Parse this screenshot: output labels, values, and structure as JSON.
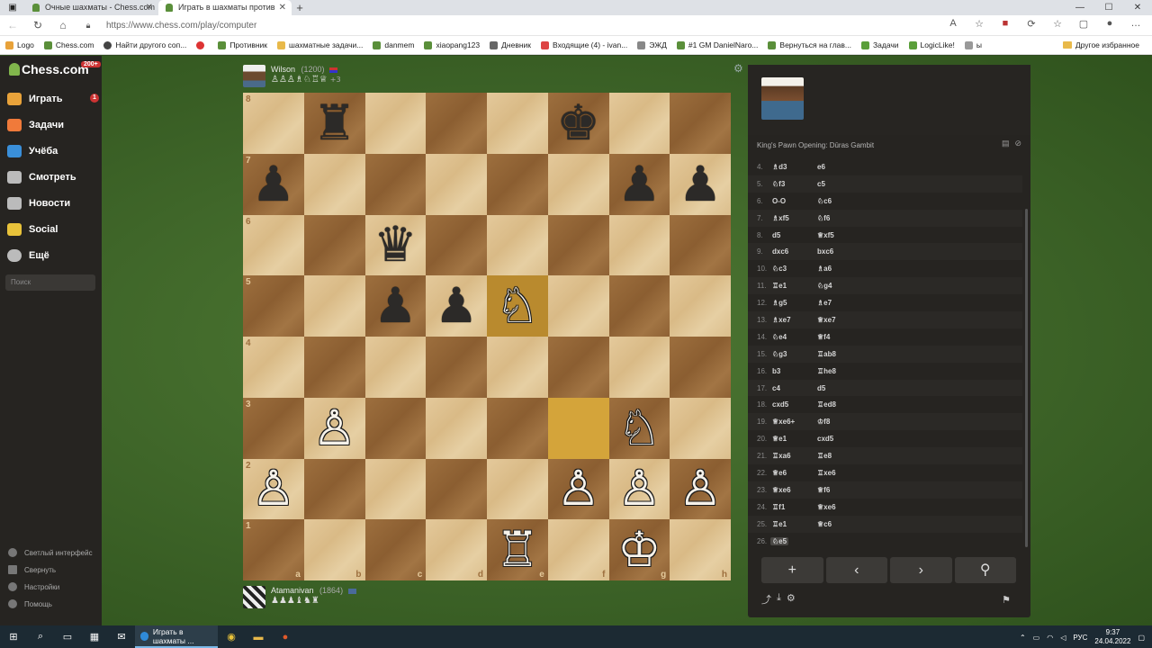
{
  "browser": {
    "tabs": [
      {
        "title": "Очные шахматы - Chess.com",
        "active": false
      },
      {
        "title": "Играть в шахматы против",
        "active": true
      }
    ],
    "url": "https://www.chess.com/play/computer",
    "bookmarks": [
      "Logo",
      "Chess.com",
      "Найти другого соп...",
      "Противник",
      "шахматные задачи...",
      "danmem",
      "xiaopang123",
      "Дневник",
      "Входящие (4) - ivan...",
      "ЭЖД",
      "#1 GM DanielNaro...",
      "Вернуться на глав...",
      "Задачи",
      "LogicLike!",
      "ы"
    ],
    "bookmarks_right": "Другое избранное"
  },
  "sidebar": {
    "logo": "Chess.com",
    "logo_badge": "200+",
    "items": [
      {
        "label": "Играть",
        "badge": "1"
      },
      {
        "label": "Задачи"
      },
      {
        "label": "Учёба"
      },
      {
        "label": "Смотреть"
      },
      {
        "label": "Новости"
      },
      {
        "label": "Social"
      },
      {
        "label": "Ещё"
      }
    ],
    "search_placeholder": "Поиск",
    "bottom": [
      "Светлый интерфейс",
      "Свернуть",
      "Настройки",
      "Помощь"
    ]
  },
  "top_player": {
    "name": "Wilson",
    "rating": "(1200)",
    "captured": "♙♙♙♗♘♖♕",
    "advantage": "+3"
  },
  "bottom_player": {
    "name": "Atamanivan",
    "rating": "(1864)",
    "captured": "♟♟♟♝♞♜"
  },
  "board": {
    "files": [
      "a",
      "b",
      "c",
      "d",
      "e",
      "f",
      "g",
      "h"
    ],
    "ranks": [
      "8",
      "7",
      "6",
      "5",
      "4",
      "3",
      "2",
      "1"
    ],
    "highlight": [
      "e5",
      "f3"
    ],
    "pieces": {
      "b8": "♜",
      "f8": "♚",
      "a7": "♟",
      "g7": "♟",
      "h7": "♟",
      "c6": "♛",
      "c5": "♟",
      "d5": "♟",
      "e5": "♘",
      "b3": "♙",
      "g3": "♘",
      "a2": "♙",
      "f2": "♙",
      "g2": "♙",
      "h2": "♙",
      "e1": "♖",
      "g1": "♔"
    },
    "white_pieces": [
      "e5",
      "b3",
      "g3",
      "a2",
      "f2",
      "g2",
      "h2",
      "e1",
      "g1"
    ]
  },
  "panel": {
    "opening": "King's Pawn Opening: Dūras Gambit",
    "moves": [
      {
        "n": "4.",
        "w": "♗d3",
        "b": "e6"
      },
      {
        "n": "5.",
        "w": "♘f3",
        "b": "c5"
      },
      {
        "n": "6.",
        "w": "O-O",
        "b": "♘c6"
      },
      {
        "n": "7.",
        "w": "♗xf5",
        "b": "♘f6"
      },
      {
        "n": "8.",
        "w": "d5",
        "b": "♕xf5"
      },
      {
        "n": "9.",
        "w": "dxc6",
        "b": "bxc6"
      },
      {
        "n": "10.",
        "w": "♘c3",
        "b": "♗a6"
      },
      {
        "n": "11.",
        "w": "♖e1",
        "b": "♘g4"
      },
      {
        "n": "12.",
        "w": "♗g5",
        "b": "♗e7"
      },
      {
        "n": "13.",
        "w": "♗xe7",
        "b": "♕xe7"
      },
      {
        "n": "14.",
        "w": "♘e4",
        "b": "♕f4"
      },
      {
        "n": "15.",
        "w": "♘g3",
        "b": "♖ab8"
      },
      {
        "n": "16.",
        "w": "b3",
        "b": "♖he8"
      },
      {
        "n": "17.",
        "w": "c4",
        "b": "d5"
      },
      {
        "n": "18.",
        "w": "cxd5",
        "b": "♖ed8"
      },
      {
        "n": "19.",
        "w": "♕xe6+",
        "b": "♔f8"
      },
      {
        "n": "20.",
        "w": "♕e1",
        "b": "cxd5"
      },
      {
        "n": "21.",
        "w": "♖xa6",
        "b": "♖e8"
      },
      {
        "n": "22.",
        "w": "♕e6",
        "b": "♖xe6"
      },
      {
        "n": "23.",
        "w": "♕xe6",
        "b": "♕f6"
      },
      {
        "n": "24.",
        "w": "♖f1",
        "b": "♕xe6"
      },
      {
        "n": "25.",
        "w": "♖e1",
        "b": "♕c6"
      },
      {
        "n": "26.",
        "w": "♘e5",
        "b": ""
      }
    ],
    "controls": [
      "+",
      "‹",
      "›",
      "⚲"
    ]
  },
  "taskbar": {
    "app_label": "Играть в шахматы ...",
    "lang": "РУС",
    "time": "9:37",
    "date": "24.04.2022"
  },
  "colors": {
    "sidebar_bg": "#262421",
    "panel_bg": "#262421",
    "board_light": "#e4c99b",
    "board_dark": "#9d6f3e",
    "highlight": "#d4a43a",
    "green_accent": "#81b64c"
  }
}
